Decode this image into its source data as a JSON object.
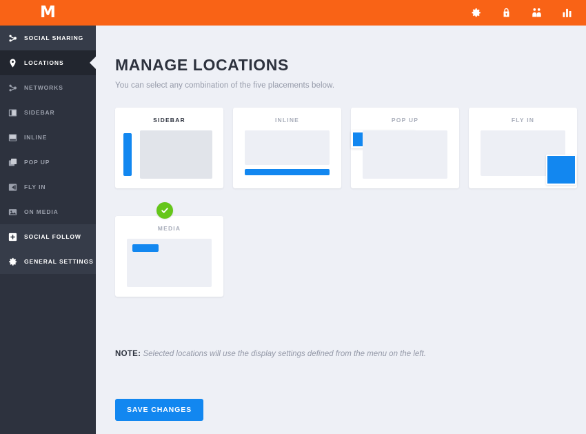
{
  "brand": {
    "logo_text": "M",
    "header_color": "#f96316",
    "sidebar_color": "#2d323e",
    "accent_blue": "#1287f0",
    "success_green": "#65c61a",
    "page_bg": "#eef0f6"
  },
  "header": {
    "icons": [
      {
        "name": "gear-icon",
        "label": "Settings"
      },
      {
        "name": "lock-icon",
        "label": "Security"
      },
      {
        "name": "users-icon",
        "label": "Users"
      },
      {
        "name": "bar-chart-icon",
        "label": "Analytics"
      }
    ]
  },
  "sidebar": {
    "items": [
      {
        "label": "SOCIAL SHARING",
        "icon": "share-node-icon",
        "state": "group"
      },
      {
        "label": "LOCATIONS",
        "icon": "map-pin-icon",
        "state": "active"
      },
      {
        "label": "NETWORKS",
        "icon": "share-node-icon",
        "state": "sub"
      },
      {
        "label": "SIDEBAR",
        "icon": "sidebar-layout-icon",
        "state": "sub"
      },
      {
        "label": "INLINE",
        "icon": "inline-layout-icon",
        "state": "sub"
      },
      {
        "label": "POP UP",
        "icon": "layers-icon",
        "state": "sub"
      },
      {
        "label": "FLY IN",
        "icon": "fly-in-icon",
        "state": "sub"
      },
      {
        "label": "ON MEDIA",
        "icon": "image-icon",
        "state": "sub"
      },
      {
        "label": "SOCIAL FOLLOW",
        "icon": "plus-box-icon",
        "state": "group"
      },
      {
        "label": "GENERAL SETTINGS",
        "icon": "gear-icon",
        "state": "group"
      }
    ]
  },
  "main": {
    "title": "MANAGE LOCATIONS",
    "subtitle": "You can select any combination of the five placements below.",
    "cards": [
      {
        "title": "SIDEBAR",
        "selected": true
      },
      {
        "title": "INLINE",
        "selected": false
      },
      {
        "title": "POP UP",
        "selected": false
      },
      {
        "title": "FLY IN",
        "selected": false
      },
      {
        "title": "MEDIA",
        "selected": false
      }
    ],
    "selected_badge": {
      "name": "check-circle-icon",
      "shown": true
    },
    "note_label": "NOTE:",
    "note_text": "Selected locations will use the display settings defined from the menu on the left.",
    "save_label": "SAVE CHANGES"
  }
}
